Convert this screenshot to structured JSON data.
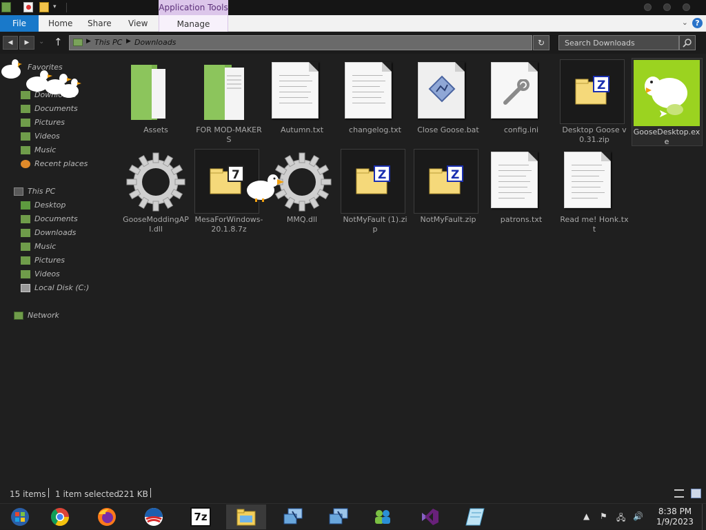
{
  "titlebar": {
    "context_tab": "Application Tools"
  },
  "ribbon": {
    "tabs": [
      "File",
      "Home",
      "Share",
      "View",
      "Manage"
    ],
    "help": "?"
  },
  "address": {
    "crumbs": [
      "This PC",
      "Downloads"
    ],
    "search_placeholder": "Search Downloads"
  },
  "nav": {
    "favorites_header": "Favorites",
    "favorites": [
      "Downloads",
      "Documents",
      "Pictures",
      "Videos",
      "Music",
      "Recent places"
    ],
    "thispc_header": "This PC",
    "thispc": [
      "Desktop",
      "Documents",
      "Downloads",
      "Music",
      "Pictures",
      "Videos",
      "Local Disk (C:)"
    ],
    "network": "Network"
  },
  "files": [
    {
      "name": "Assets",
      "icon": "folder-icon"
    },
    {
      "name": "FOR MOD-MAKERS",
      "icon": "folder-icon"
    },
    {
      "name": "Autumn.txt",
      "icon": "text-file-icon"
    },
    {
      "name": "changelog.txt",
      "icon": "text-file-icon"
    },
    {
      "name": "Close Goose.bat",
      "icon": "batch-file-icon"
    },
    {
      "name": "config.ini",
      "icon": "settings-file-icon"
    },
    {
      "name": "Desktop Goose v0.31.zip",
      "icon": "zip-icon"
    },
    {
      "name": "GooseDesktop.exe",
      "icon": "goose-app-icon"
    },
    {
      "name": "GooseModdingAPI.dll",
      "icon": "gear-icon"
    },
    {
      "name": "MesaForWindows-20.1.8.7z",
      "icon": "7z-archive-icon"
    },
    {
      "name": "MMQ.dll",
      "icon": "gear-icon"
    },
    {
      "name": "NotMyFault (1).zip",
      "icon": "zip-icon"
    },
    {
      "name": "NotMyFault.zip",
      "icon": "zip-icon"
    },
    {
      "name": "patrons.txt",
      "icon": "text-file-icon"
    },
    {
      "name": "Read me! Honk.txt",
      "icon": "text-file-icon"
    }
  ],
  "status": {
    "count": "15 items",
    "selected": "1 item selected",
    "size": "221 KB"
  },
  "taskbar": {
    "apps": [
      "start-orb-icon",
      "chrome-icon",
      "firefox-icon",
      "obama-logo-icon",
      "7zip-icon",
      "file-explorer-icon",
      "remote-desktop-icon",
      "remote-desktop-icon",
      "users-icon",
      "visual-studio-icon",
      "notepad-icon"
    ],
    "time": "8:38 PM",
    "date": "1/9/2023"
  },
  "colors": {
    "accent": "#1979ca",
    "folder_green": "#7fbf5a",
    "goose_bg": "#9bd320",
    "context_tab": "#dcc6ea"
  }
}
